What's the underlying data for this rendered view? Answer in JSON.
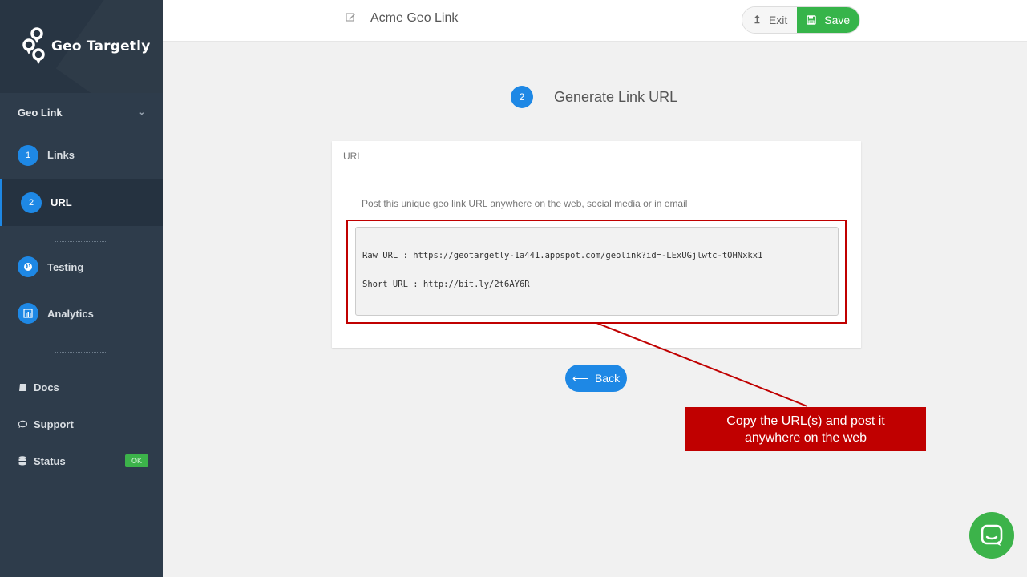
{
  "brand": {
    "name": "Geo Targetly"
  },
  "sidebar": {
    "group_label": "Geo Link",
    "steps": [
      {
        "num": "1",
        "label": "Links"
      },
      {
        "num": "2",
        "label": "URL"
      }
    ],
    "tools": [
      {
        "label": "Testing",
        "icon": "globe-icon"
      },
      {
        "label": "Analytics",
        "icon": "bar-chart-icon"
      }
    ],
    "bottom": [
      {
        "label": "Docs",
        "icon": "book-icon"
      },
      {
        "label": "Support",
        "icon": "chat-bubble-icon"
      },
      {
        "label": "Status",
        "icon": "database-icon",
        "badge": "OK"
      }
    ]
  },
  "header": {
    "title": "Acme Geo Link",
    "exit_label": "Exit",
    "save_label": "Save"
  },
  "step": {
    "num": "2",
    "title": "Generate Link URL"
  },
  "card": {
    "header": "URL",
    "description": "Post this unique geo link URL anywhere on the web, social media or in email",
    "raw_url": "Raw URL : https://geotargetly-1a441.appspot.com/geolink?id=-LExUGjlwtc-tOHNxkx1",
    "short_url": "Short URL : http://bit.ly/2t6AY6R"
  },
  "back_label": "Back",
  "callout": "Copy the URL(s) and post it anywhere on the web",
  "colors": {
    "accent": "#1e88e5",
    "save": "#36b44a",
    "callout": "#c00000",
    "sidebar": "#2e3c4b"
  }
}
